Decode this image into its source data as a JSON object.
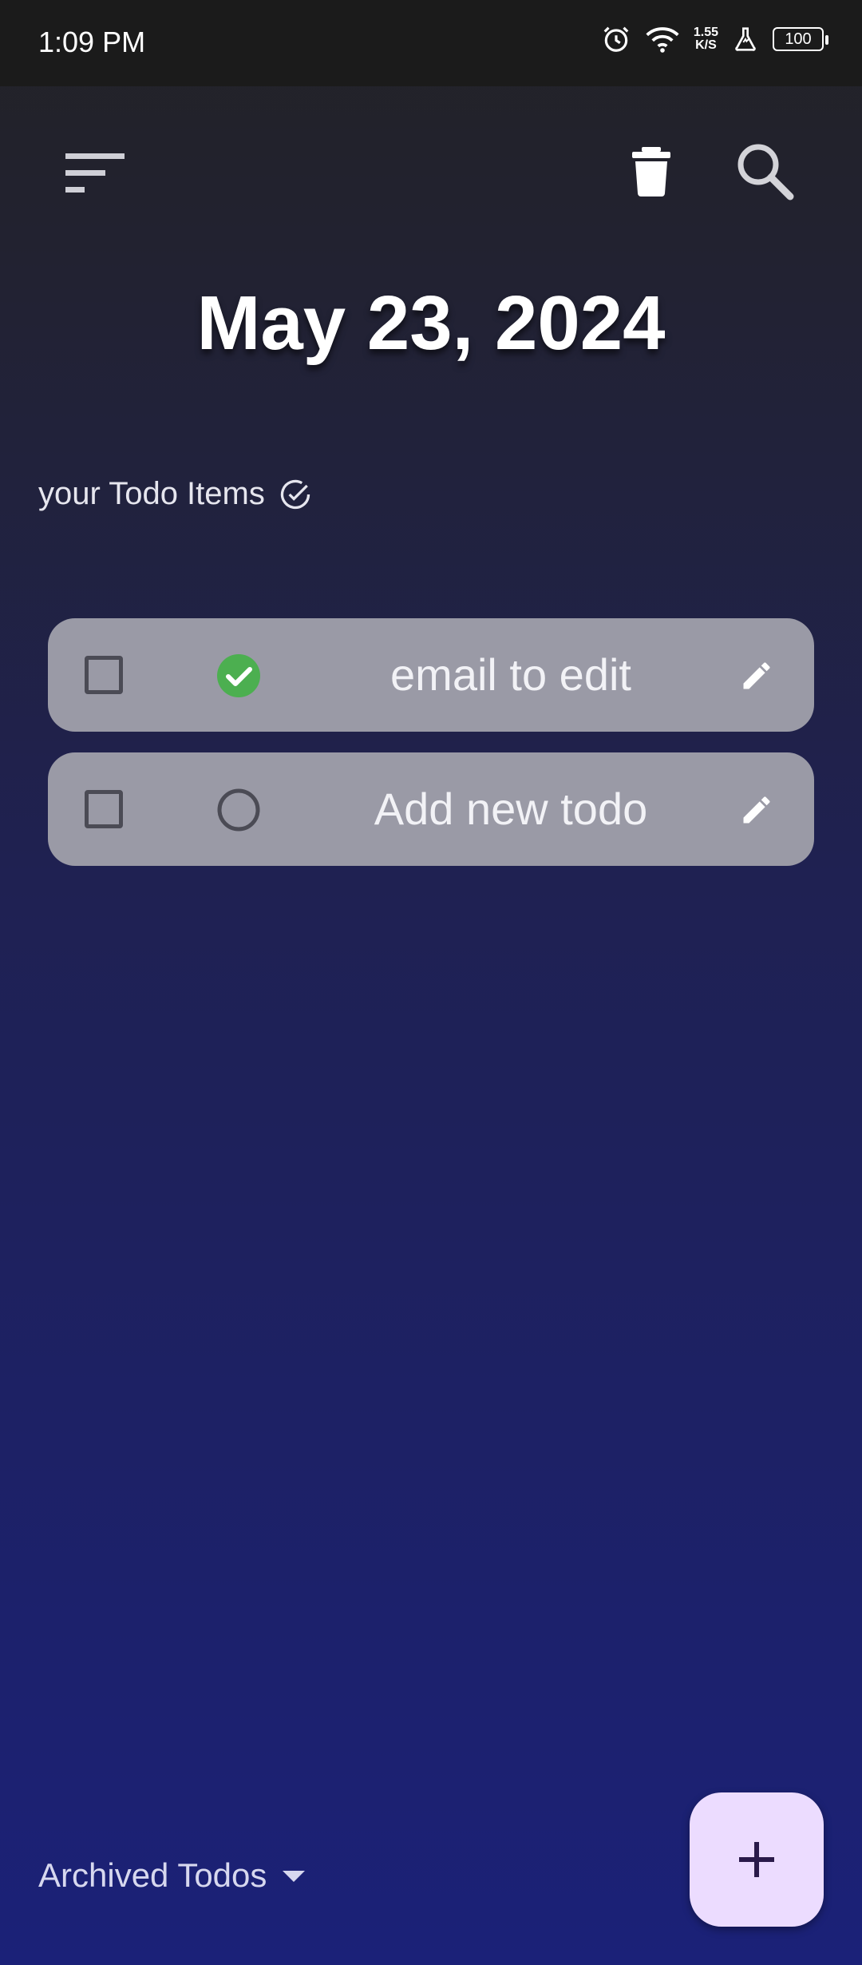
{
  "status_bar": {
    "time": "1:09 PM",
    "speed_value": "1.55",
    "speed_unit": "K/S",
    "battery": "100"
  },
  "header": {
    "date": "May 23, 2024"
  },
  "section": {
    "label": "your Todo Items"
  },
  "todos": [
    {
      "text": "email to edit",
      "done": true
    },
    {
      "text": "Add new todo",
      "done": false
    }
  ],
  "footer": {
    "archived_label": "Archived Todos"
  },
  "colors": {
    "card": "#9a9aa6",
    "done_green": "#4caf50",
    "fab": "#ecdcff"
  },
  "icons": [
    "sort-icon",
    "trash-icon",
    "search-icon",
    "check-circle-icon",
    "empty-circle-icon",
    "edit-icon",
    "dropdown-arrow-icon",
    "plus-icon"
  ]
}
